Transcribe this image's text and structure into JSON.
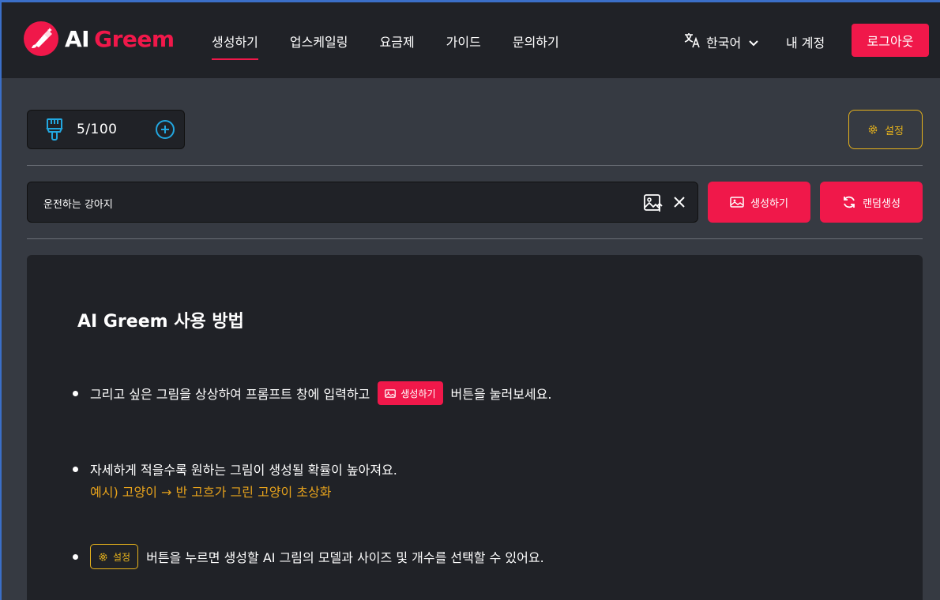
{
  "header": {
    "logo": {
      "ai": "AI",
      "name": "Greem"
    },
    "nav": [
      {
        "label": "생성하기",
        "active": true
      },
      {
        "label": "업스케일링",
        "active": false
      },
      {
        "label": "요금제",
        "active": false
      },
      {
        "label": "가이드",
        "active": false
      },
      {
        "label": "문의하기",
        "active": false
      }
    ],
    "language": "한국어",
    "account": "내 계정",
    "logout": "로그아웃"
  },
  "credits": {
    "value": "5/100"
  },
  "settings_label": "설정",
  "prompt": {
    "value": "운전하는 강아지",
    "placeholder": ""
  },
  "buttons": {
    "generate": "생성하기",
    "random": "랜덤생성"
  },
  "guide": {
    "title": "AI Greem 사용 방법",
    "tip1": {
      "before": "그리고 싶은 그림을 상상하여 프롬프트 창에 입력하고",
      "badge": "생성하기",
      "after": "버튼을 눌러보세요."
    },
    "tip2": {
      "text": "자세하게 적을수록 원하는 그림이 생성될 확률이 높아져요.",
      "example": "예시) 고양이 → 반 고흐가 그린 고양이 초상화"
    },
    "tip3": {
      "badge": "설정",
      "after": "버튼을 누르면 생성할 AI 그림의 모델과 사이즈 및 개수를 선택할 수 있어요."
    }
  },
  "colors": {
    "brand": "#f0184a",
    "accent_yellow": "#e6b21c",
    "accent_blue": "#22a7e0"
  }
}
